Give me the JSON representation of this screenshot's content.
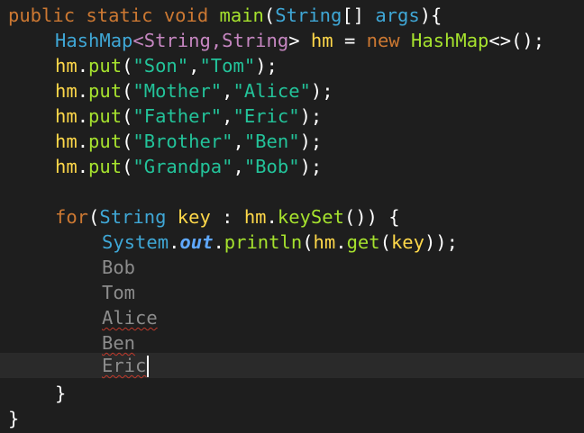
{
  "code": {
    "line1": {
      "kw_public": "public",
      "kw_static": "static",
      "kw_void": "void",
      "method": "main",
      "paren_open": "(",
      "type": "String",
      "brackets": "[]",
      "param": "args",
      "close": "){"
    },
    "line2": {
      "type1": "HashMap",
      "lt": "<",
      "gen1": "String",
      "comma": ",",
      "gen2": "String",
      "gt": ">",
      "var": "hm",
      "eq": "=",
      "kw_new": "new",
      "type2": "HashMap",
      "diamond": "<>();"
    },
    "puts": [
      {
        "var": "hm",
        "dot": ".",
        "method": "put",
        "open": "(",
        "key": "\"Son\"",
        "comma": ",",
        "value": "\"Tom\"",
        "close": ");"
      },
      {
        "var": "hm",
        "dot": ".",
        "method": "put",
        "open": "(",
        "key": "\"Mother\"",
        "comma": ",",
        "value": "\"Alice\"",
        "close": ");"
      },
      {
        "var": "hm",
        "dot": ".",
        "method": "put",
        "open": "(",
        "key": "\"Father\"",
        "comma": ",",
        "value": "\"Eric\"",
        "close": ");"
      },
      {
        "var": "hm",
        "dot": ".",
        "method": "put",
        "open": "(",
        "key": "\"Brother\"",
        "comma": ",",
        "value": "\"Ben\"",
        "close": ");"
      },
      {
        "var": "hm",
        "dot": ".",
        "method": "put",
        "open": "(",
        "key": "\"Grandpa\"",
        "comma": ",",
        "value": "\"Bob\"",
        "close": ");"
      }
    ],
    "for_line": {
      "kw_for": "for",
      "open": "(",
      "type": "String",
      "var_key": "key",
      "colon": ":",
      "var_hm": "hm",
      "dot": ".",
      "method": "keySet",
      "close": "()) {"
    },
    "print_line": {
      "type": "System",
      "dot1": ".",
      "field": "out",
      "dot2": ".",
      "method": "println",
      "open": "(",
      "var_hm": "hm",
      "dot3": ".",
      "method_get": "get",
      "open2": "(",
      "var_key": "key",
      "close": "));"
    },
    "output": [
      "Bob",
      "Tom",
      "Alice",
      "Ben",
      "Eric"
    ],
    "close_for": "}",
    "close_main": "}"
  }
}
